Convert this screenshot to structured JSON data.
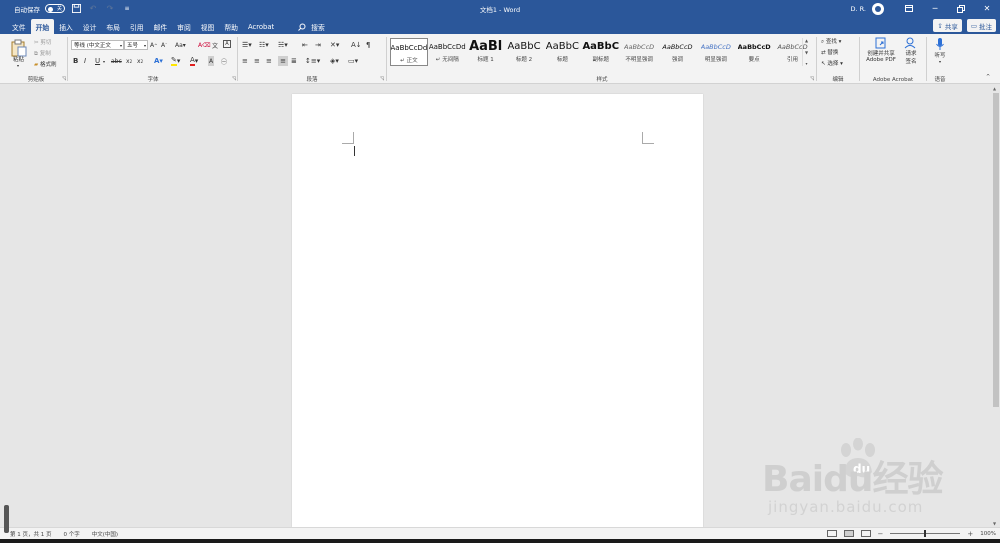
{
  "titlebar": {
    "autosave_label": "自动保存",
    "autosave_state": "关",
    "doc_title": "文档1 - Word",
    "user_name": "D. R."
  },
  "tabs": [
    {
      "label": "文件",
      "active": false
    },
    {
      "label": "开始",
      "active": true
    },
    {
      "label": "插入",
      "active": false
    },
    {
      "label": "设计",
      "active": false
    },
    {
      "label": "布局",
      "active": false
    },
    {
      "label": "引用",
      "active": false
    },
    {
      "label": "邮件",
      "active": false
    },
    {
      "label": "审阅",
      "active": false
    },
    {
      "label": "视图",
      "active": false
    },
    {
      "label": "帮助",
      "active": false
    },
    {
      "label": "Acrobat",
      "active": false
    }
  ],
  "search_label": "搜索",
  "share_label": "共享",
  "comments_label": "批注",
  "ribbon": {
    "clipboard": {
      "paste": "粘贴",
      "cut": "剪切",
      "copy": "复制",
      "format_painter": "格式刷",
      "label": "剪贴板"
    },
    "font": {
      "font_name": "等线 (中文正文",
      "font_size": "五号",
      "label": "字体"
    },
    "paragraph": {
      "label": "段落"
    },
    "styles": {
      "label": "样式",
      "items": [
        {
          "sample": "AaBbCcDd",
          "name": "正文",
          "selected": true
        },
        {
          "sample": "AaBbCcDd",
          "name": "无间隔",
          "selected": false
        },
        {
          "sample": "AaBl",
          "name": "标题 1",
          "selected": false
        },
        {
          "sample": "AaBbC",
          "name": "标题 2",
          "selected": false
        },
        {
          "sample": "AaBbC",
          "name": "标题",
          "selected": false
        },
        {
          "sample": "AaBbC",
          "name": "副标题",
          "selected": false
        },
        {
          "sample": "AaBbCcD",
          "name": "不明显强调",
          "selected": false
        },
        {
          "sample": "AaBbCcD",
          "name": "强调",
          "selected": false
        },
        {
          "sample": "AaBbCcD",
          "name": "明显强调",
          "selected": false
        },
        {
          "sample": "AaBbCcD",
          "name": "要点",
          "selected": false
        },
        {
          "sample": "AaBbCcD",
          "name": "引用",
          "selected": false
        }
      ]
    },
    "editing": {
      "find": "查找",
      "replace": "替换",
      "select": "选择",
      "label": "编辑"
    },
    "acrobat": {
      "create_pdf_line1": "创建并共享",
      "create_pdf_line2": "Adobe PDF",
      "request_sign_line1": "请求",
      "request_sign_line2": "签名",
      "label": "Adobe Acrobat"
    },
    "voice": {
      "dictate": "听写",
      "label": "语音"
    }
  },
  "statusbar": {
    "page": "第 1 页，共 1 页",
    "words": "0 个字",
    "language": "中文(中国)",
    "zoom": "100%"
  },
  "watermark": {
    "logo": "Baidu经验",
    "url": "jingyan.baidu.com"
  },
  "colors": {
    "brand": "#2b579a",
    "ribbon_bg": "#f3f3f3",
    "canvas_bg": "#e6e6e6",
    "highlight_yellow": "#ffe600",
    "font_color_red": "#e02020"
  }
}
